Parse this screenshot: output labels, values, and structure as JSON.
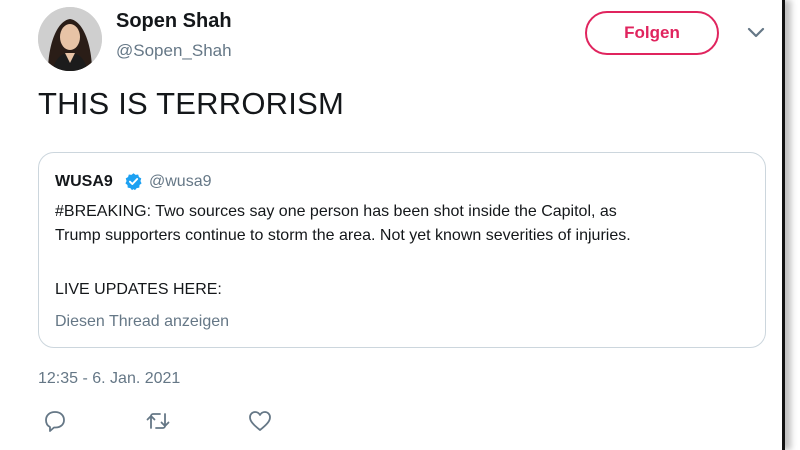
{
  "author": {
    "name": "Sopen Shah",
    "handle": "@Sopen_Shah"
  },
  "follow_label": "Folgen",
  "tweet_text": "THIS IS TERRORISM",
  "quoted_tweet": {
    "name": "WUSA9",
    "handle": "@wusa9",
    "body_lines": [
      "#BREAKING: Two sources say one person has been shot inside the Capitol, as",
      "Trump supporters continue to storm the area. Not yet known severities of injuries."
    ],
    "live_updates": "LIVE UPDATES HERE:",
    "show_thread": "Diesen Thread anzeigen"
  },
  "timestamp": "12:35 - 6. Jan. 2021",
  "icons": {
    "menu": "chevron-down-icon",
    "verified": "verified-badge-icon",
    "reply": "reply-icon",
    "retweet": "retweet-icon",
    "like": "heart-icon"
  },
  "colors": {
    "follow_accent": "#e0245e",
    "verified": "#1da1f2",
    "secondary_text": "#657786",
    "primary_text": "#14171a"
  }
}
